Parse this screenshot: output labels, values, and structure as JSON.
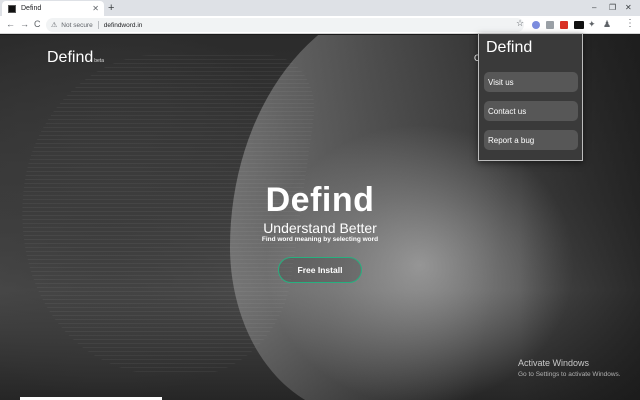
{
  "browser": {
    "tab": {
      "title": "Defind",
      "favicon": "defind-favicon",
      "close_glyph": "✕"
    },
    "new_tab_glyph": "+",
    "window_controls": {
      "minimize": "–",
      "maximize": "❐",
      "close": "✕"
    },
    "toolbar": {
      "back_glyph": "←",
      "forward_glyph": "→",
      "reload_glyph": "C",
      "security_icon": "⚠",
      "security_label": "Not secure",
      "url": "defindword.in",
      "bookmark_glyph": "☆",
      "extensions_glyph": "✦",
      "profile_glyph": "♟",
      "menu_glyph": "⋮"
    }
  },
  "site": {
    "logo": "Defind",
    "logo_badge": "beta",
    "nav_peek": "C",
    "hero": {
      "title": "Defind",
      "subtitle": "Understand Better",
      "tagline": "Find word meaning by selecting word",
      "install_button": "Free Install"
    }
  },
  "popup": {
    "title": "Defind",
    "items": [
      {
        "label": "Visit us"
      },
      {
        "label": "Contact us"
      },
      {
        "label": "Report a bug"
      }
    ]
  },
  "os_overlay": {
    "activate_title": "Activate Windows",
    "activate_sub": "Go to Settings to activate Windows."
  },
  "colors": {
    "accent_button_border": "#27b07f",
    "popup_background": "#3a3a3a",
    "popup_item": "#575757"
  }
}
